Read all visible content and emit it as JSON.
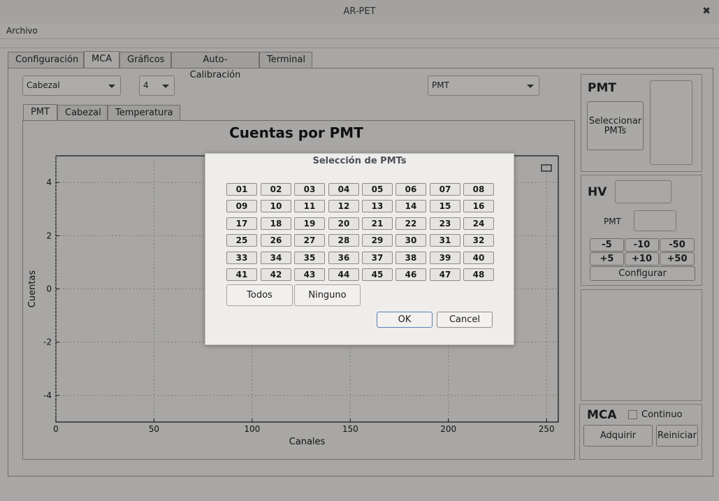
{
  "window": {
    "title": "AR-PET",
    "close_glyph": "✖"
  },
  "menu": {
    "archivo": "Archivo"
  },
  "tabs": [
    "Configuración",
    "MCA",
    "Gráficos",
    "Auto-Calibración",
    "Terminal"
  ],
  "controls": {
    "cabezal_select": "Cabezal",
    "number_select": "4",
    "pmt_select": "PMT"
  },
  "subtabs": [
    "PMT",
    "Cabezal",
    "Temperatura"
  ],
  "chart_data": {
    "type": "line",
    "title": "Cuentas por PMT",
    "xlabel": "Canales",
    "ylabel": "Cuentas",
    "xlim": [
      0,
      256
    ],
    "ylim": [
      -5,
      5
    ],
    "xticks": [
      "0",
      "50",
      "100",
      "150",
      "200",
      "250"
    ],
    "yticks": [
      "4",
      "2",
      "0",
      "-2",
      "-4"
    ],
    "grid": true,
    "series": []
  },
  "pmt_panel": {
    "title": "PMT",
    "select_button": "Seleccionar\nPMTs"
  },
  "hv_panel": {
    "title": "HV",
    "pmt_label": "PMT",
    "minus_buttons": [
      "-5",
      "-10",
      "-50"
    ],
    "plus_buttons": [
      "+5",
      "+10",
      "+50"
    ],
    "configure": "Configurar"
  },
  "mca_panel": {
    "title": "MCA",
    "continuo": "Continuo",
    "adquirir": "Adquirir",
    "reiniciar": "Reiniciar"
  },
  "dialog": {
    "title": "Selección de PMTs",
    "pmts": [
      "01",
      "02",
      "03",
      "04",
      "05",
      "06",
      "07",
      "08",
      "09",
      "10",
      "11",
      "12",
      "13",
      "14",
      "15",
      "16",
      "17",
      "18",
      "19",
      "20",
      "21",
      "22",
      "23",
      "24",
      "25",
      "26",
      "27",
      "28",
      "29",
      "30",
      "31",
      "32",
      "33",
      "34",
      "35",
      "36",
      "37",
      "38",
      "39",
      "40",
      "41",
      "42",
      "43",
      "44",
      "45",
      "46",
      "47",
      "48"
    ],
    "todos": "Todos",
    "ninguno": "Ninguno",
    "ok": "OK",
    "cancel": "Cancel"
  }
}
